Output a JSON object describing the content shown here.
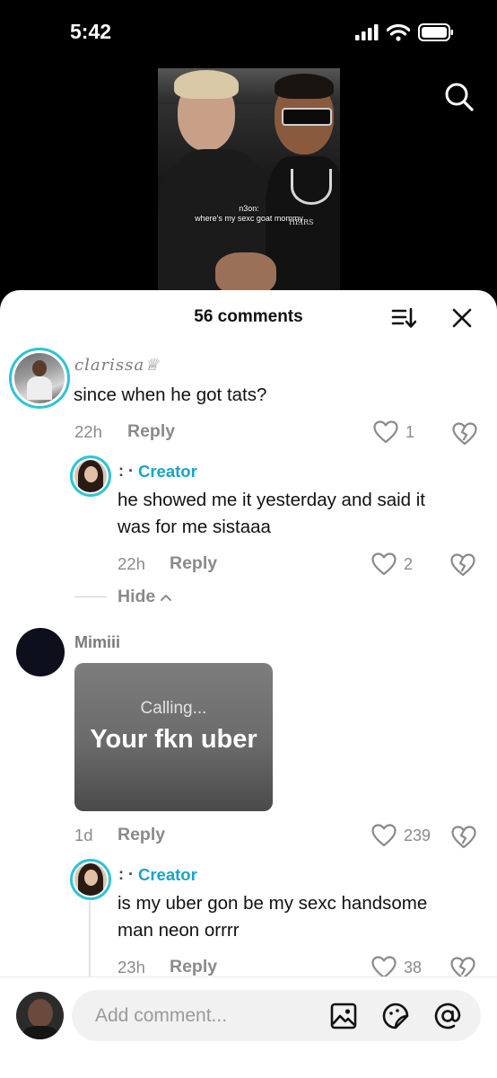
{
  "status_bar": {
    "time": "5:42"
  },
  "video": {
    "caption_line1": "n3on:",
    "caption_line2": "where's my sexc goat mommy",
    "shirt_text": "HEIRS"
  },
  "comments_header": {
    "title": "56 comments"
  },
  "comments": [
    {
      "username": "clarissa♕",
      "text": "since when he got tats?",
      "time": "22h",
      "reply_label": "Reply",
      "likes": "1",
      "replies": [
        {
          "username_prefix": ": ·",
          "badge": "Creator",
          "text_line1": "he showed me it yesterday and said it",
          "text_line2": "was for me sistaaa",
          "time": "22h",
          "reply_label": "Reply",
          "likes": "2"
        }
      ],
      "hide_label": "Hide"
    },
    {
      "username": "Mimiii",
      "gif_small": "Calling...",
      "gif_big": "Your fkn uber",
      "time": "1d",
      "reply_label": "Reply",
      "likes": "239",
      "replies": [
        {
          "username_prefix": ": ·",
          "badge": "Creator",
          "text_line1": "is my uber gon be my sexc handsome",
          "text_line2": "man neon orrrr",
          "time": "23h",
          "reply_label": "Reply",
          "likes": "38"
        }
      ]
    }
  ],
  "composer": {
    "placeholder": "Add comment..."
  },
  "colors": {
    "accent": "#19a4c6",
    "ring": "#2ec4d6",
    "muted": "#8a8a8a"
  },
  "icons": [
    "signal-icon",
    "wifi-icon",
    "battery-icon",
    "search-icon",
    "sort-icon",
    "close-icon",
    "heart-icon",
    "broken-heart-icon",
    "chevron-up-icon",
    "image-icon",
    "sticker-icon",
    "mention-icon"
  ]
}
